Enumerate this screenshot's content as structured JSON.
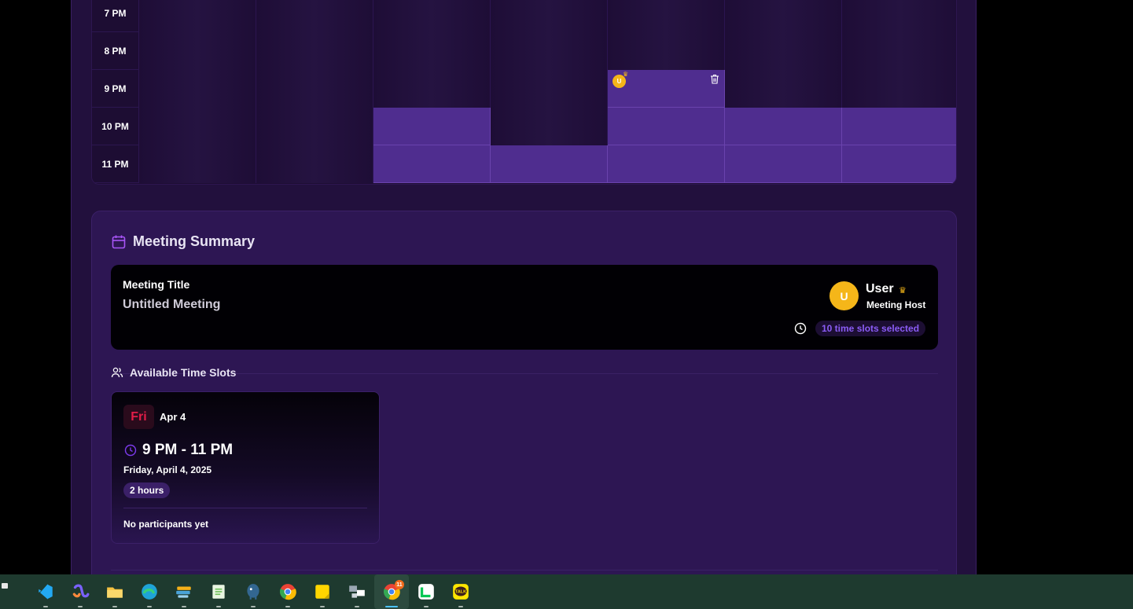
{
  "schedule": {
    "rows": [
      {
        "time": "7 PM",
        "cells": [
          false,
          false,
          false,
          false,
          false,
          false,
          false
        ]
      },
      {
        "time": "8 PM",
        "cells": [
          false,
          false,
          false,
          false,
          false,
          false,
          false
        ]
      },
      {
        "time": "9 PM",
        "cells": [
          false,
          false,
          false,
          false,
          true,
          false,
          false
        ]
      },
      {
        "time": "10 PM",
        "cells": [
          false,
          false,
          true,
          false,
          true,
          true,
          true
        ]
      },
      {
        "time": "11 PM",
        "cells": [
          false,
          false,
          true,
          true,
          true,
          true,
          true
        ]
      }
    ],
    "slot_avatar_initial": "U"
  },
  "summary": {
    "heading": "Meeting Summary",
    "meeting_title_label": "Meeting Title",
    "meeting_title": "Untitled Meeting",
    "host": {
      "initial": "U",
      "name": "User",
      "role": "Meeting Host"
    },
    "slots_selected": "10 time slots selected",
    "available_heading": "Available Time Slots",
    "slot_card": {
      "day": "Fri",
      "date_short": "Apr 4",
      "time_range": "9 PM - 11 PM",
      "date_long": "Friday, April 4, 2025",
      "duration": "2 hours",
      "participants": "No participants yet"
    }
  },
  "taskbar": {
    "apps": [
      {
        "name": "vscode-icon",
        "color": "#23a9f2"
      },
      {
        "name": "copilot-icon",
        "color": "#7b61ff"
      },
      {
        "name": "file-explorer-icon",
        "color": "#f6c140"
      },
      {
        "name": "edge-icon",
        "color": "#1fa3d8"
      },
      {
        "name": "app-icon",
        "color": "#4aa3d8"
      },
      {
        "name": "notepad-icon",
        "color": "#6fbf5a"
      },
      {
        "name": "postgres-icon",
        "color": "#336791"
      },
      {
        "name": "chrome-icon",
        "color": "#4285f4"
      },
      {
        "name": "sticky-notes-icon",
        "color": "#ffd600"
      },
      {
        "name": "network-icon",
        "color": "#9aa7b3"
      },
      {
        "name": "chrome-dev-icon",
        "color": "#4285f4",
        "badge": "11"
      },
      {
        "name": "line-icon",
        "color": "#06c755"
      },
      {
        "name": "kakaotalk-icon",
        "color": "#fee500"
      }
    ]
  }
}
